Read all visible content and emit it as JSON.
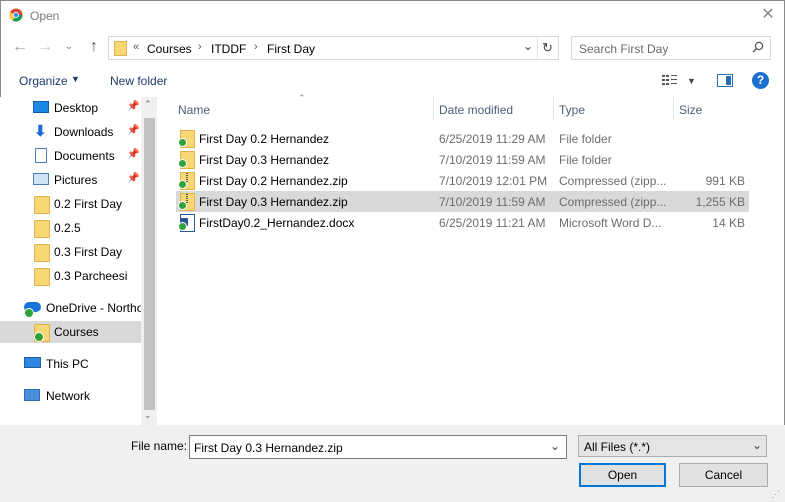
{
  "window": {
    "title": "Open"
  },
  "address": {
    "overflow": "«",
    "crumbs": [
      "Courses",
      "ITDDF",
      "First Day"
    ]
  },
  "search": {
    "placeholder": "Search First Day"
  },
  "toolbar": {
    "organize": "Organize",
    "new_folder": "New folder"
  },
  "nav": {
    "items": [
      {
        "label": "Desktop",
        "icon": "desktop-icon",
        "pinned": true
      },
      {
        "label": "Downloads",
        "icon": "download-icon",
        "pinned": true
      },
      {
        "label": "Documents",
        "icon": "documents-icon",
        "pinned": true
      },
      {
        "label": "Pictures",
        "icon": "pictures-icon",
        "pinned": true
      },
      {
        "label": "0.2 First Day",
        "icon": "folder-icon"
      },
      {
        "label": "0.2.5",
        "icon": "folder-icon"
      },
      {
        "label": "0.3 First Day",
        "icon": "folder-icon"
      },
      {
        "label": "0.3 Parcheesi",
        "icon": "folder-icon"
      },
      {
        "label": "OneDrive - Northo",
        "icon": "onedrive-icon"
      },
      {
        "label": "Courses",
        "icon": "folder-icon",
        "selected": true
      },
      {
        "label": "This PC",
        "icon": "pc-icon"
      },
      {
        "label": "Network",
        "icon": "network-icon"
      }
    ]
  },
  "columns": {
    "name": "Name",
    "date": "Date modified",
    "type": "Type",
    "size": "Size"
  },
  "files": [
    {
      "name": "First Day 0.2 Hernandez",
      "date": "6/25/2019 11:29 AM",
      "type": "File folder",
      "size": "",
      "icon": "folder-icon"
    },
    {
      "name": "First Day 0.3 Hernandez",
      "date": "7/10/2019 11:59 AM",
      "type": "File folder",
      "size": "",
      "icon": "folder-icon"
    },
    {
      "name": "First Day 0.2 Hernandez.zip",
      "date": "7/10/2019 12:01 PM",
      "type": "Compressed (zipp...",
      "size": "991 KB",
      "icon": "zip-icon"
    },
    {
      "name": "First Day 0.3 Hernandez.zip",
      "date": "7/10/2019 11:59 AM",
      "type": "Compressed (zipp...",
      "size": "1,255 KB",
      "icon": "zip-icon",
      "selected": true
    },
    {
      "name": "FirstDay0.2_Hernandez.docx",
      "date": "6/25/2019 11:21 AM",
      "type": "Microsoft Word D...",
      "size": "14 KB",
      "icon": "word-icon"
    }
  ],
  "bottom": {
    "file_name_label": "File name:",
    "file_name_value": "First Day 0.3 Hernandez.zip",
    "filter_value": "All Files (*.*)",
    "open_label": "Open",
    "cancel_label": "Cancel"
  },
  "colors": {
    "accent": "#0078d7",
    "selection": "#d9d9d9",
    "folder": "#f8d775",
    "sync_badge": "#2fa33a"
  }
}
